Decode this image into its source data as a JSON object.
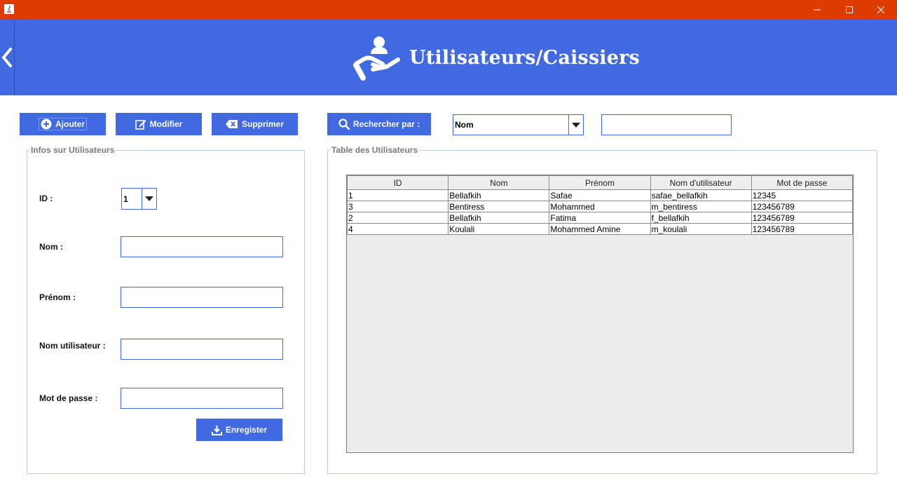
{
  "window": {
    "minimize_glyph": "—",
    "maximize_glyph": "☐",
    "close_glyph": "✕"
  },
  "header": {
    "title": "Utilisateurs/Caissiers",
    "background": "#4169e1"
  },
  "toolbar": {
    "add_label": "Ajouter",
    "edit_label": "Modifier",
    "delete_label": "Supprimer",
    "search_label": "Rechercher par :",
    "search_by_value": "Nom",
    "search_text": ""
  },
  "form": {
    "legend": "Infos sur Utilisateurs",
    "id_label": "ID :",
    "id_value": "1",
    "nom_label": "Nom :",
    "prenom_label": "Prénom :",
    "username_label": "Nom utilisateur :",
    "password_label": "Mot de passe :",
    "save_label": "Enregister"
  },
  "table": {
    "legend": "Table des Utilisateurs",
    "columns": [
      "ID",
      "Nom",
      "Prénom",
      "Nom d'utilisateur",
      "Mot de passe"
    ],
    "rows": [
      [
        "1",
        "Bellafkih",
        "Safae",
        "safae_bellafkih",
        "12345"
      ],
      [
        "3",
        "Bentiress",
        "Mohammed",
        "m_bentiress",
        "123456789"
      ],
      [
        "2",
        "Bellafkih",
        "Fatima",
        "f_bellafkih",
        "123456789"
      ],
      [
        "4",
        "Koulali",
        "Mohammed Amine",
        "m_koulali",
        "123456789"
      ]
    ]
  },
  "colors": {
    "titlebar": "#dd3b00",
    "accent": "#4169e1",
    "group_border": "#b8cfe5"
  },
  "icons": [
    "java-app-icon",
    "back-chevron-icon",
    "user-care-icon",
    "plus-circle-icon",
    "edit-icon",
    "delete-x-icon",
    "search-icon",
    "dropdown-arrow-icon",
    "download-icon"
  ]
}
